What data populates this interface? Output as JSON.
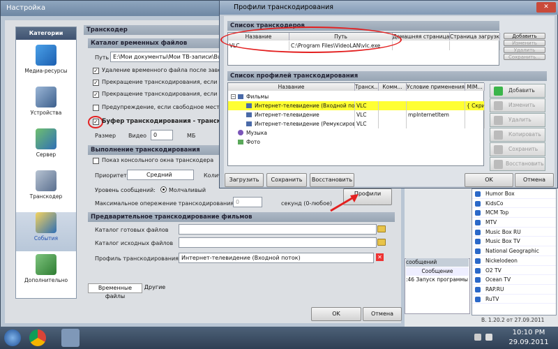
{
  "main_window": {
    "title": "Настройка",
    "categories_header": "Категории",
    "categories": [
      {
        "label": "Медиа-ресурсы"
      },
      {
        "label": "Устройства"
      },
      {
        "label": "Сервер"
      },
      {
        "label": "Транскодер"
      },
      {
        "label": "События"
      },
      {
        "label": "Дополнительно"
      }
    ],
    "panel_title": "Транскодер",
    "temp_dir": {
      "header": "Каталог временных файлов",
      "path_label": "Путь",
      "path_value": "E:\\Мои документы\\Мои ТВ-записи\\Buffer",
      "check1": "Удаление временного файла после завершен",
      "check2": "Прекращение транскодирования, если устрой",
      "check3": "Прекращение транскодирования, если время",
      "check4": "Предупреждение, если свободное место для"
    },
    "buffer": {
      "label": "Буфер транскодирования - транскодиро",
      "size_label": "Размер",
      "video_label": "Видео",
      "video_value": "0",
      "mb_label": "МБ"
    },
    "execution": {
      "header": "Выполнение транскодирования",
      "console_label": "Показ консольного окна транскодера",
      "priority_label": "Приоритет",
      "priority_value": "Средний",
      "count_label": "Колич",
      "log_level_label": "Уровень сообщений:",
      "log_level_value": "Молчаливый",
      "max_ahead_label": "Максимальное опережение транскодирования",
      "max_ahead_value": "0",
      "seconds_label": "секунд (0-любое)",
      "profiles_button": "Профили"
    },
    "preliminary": {
      "header": "Предварительное транскодирование фильмов",
      "ready_label": "Каталог готовых файлов",
      "source_label": "Каталог исходных файлов",
      "profile_label": "Профиль транскодирования",
      "profile_value": "Интернет-телевидение (Входной поток)"
    },
    "tabs": [
      "Временные файлы",
      "Другие"
    ],
    "ok_button": "OK",
    "cancel_button": "Отмена"
  },
  "dialog": {
    "title": "Профили транскодирования",
    "transcoders_header": "Список транскодеров",
    "transcoder_columns": [
      "Название",
      "Путь",
      "Домашняя страница",
      "Страница загрузки"
    ],
    "transcoders": [
      {
        "name": "VLC",
        "path": "C:\\Program Files\\VideoLAN\\vlc.exe",
        "home": "",
        "download": ""
      }
    ],
    "transcoder_buttons": [
      "Добавить",
      "Изменить",
      "Удалить",
      "Сохранить..."
    ],
    "profiles_header": "Список профилей транскодирования",
    "profile_columns": [
      "Название",
      "Транск...",
      "Комм...",
      "Условие применения",
      "MIM..."
    ],
    "tree": {
      "films": "Фильмы",
      "music": "Музыка",
      "photo": "Фото",
      "profiles": [
        {
          "name": "Интернет-телевидение (Входной поток)",
          "transcoder": "VLC",
          "comment": "",
          "condition": "",
          "mime": "{ Скрип"
        },
        {
          "name": "Интернет-телевидение",
          "transcoder": "VLC",
          "comment": "",
          "condition": "mpInternetItem",
          "mime": ""
        },
        {
          "name": "Интернет-телевидение (Ремуксирование)",
          "transcoder": "VLC",
          "comment": "",
          "condition": "",
          "mime": ""
        }
      ]
    },
    "side_buttons": [
      "Добавить",
      "Изменить",
      "Удалить",
      "Копировать",
      "Сохранить",
      "Восстановить"
    ],
    "bottom_buttons": [
      "Загрузить",
      "Сохранить",
      "Восстановить"
    ],
    "ok_button": "OK",
    "cancel_button": "Отмена"
  },
  "right_panel": {
    "channels": [
      "Humor Box",
      "KidsCo",
      "MCM Top",
      "MTV",
      "Music Box RU",
      "Music Box TV",
      "National Geographic",
      "Nickelodeon",
      "O2 TV",
      "Ocean TV",
      "RAP.RU",
      "RuTV"
    ],
    "log_header": "сообщений",
    "log_column": "Сообщение",
    "log_entry": ":46 Запуск программы",
    "version": "В. 1.20.2 от 27.09.2011"
  },
  "taskbar": {
    "time": "10:10 PM",
    "date": "29.09.2011"
  }
}
